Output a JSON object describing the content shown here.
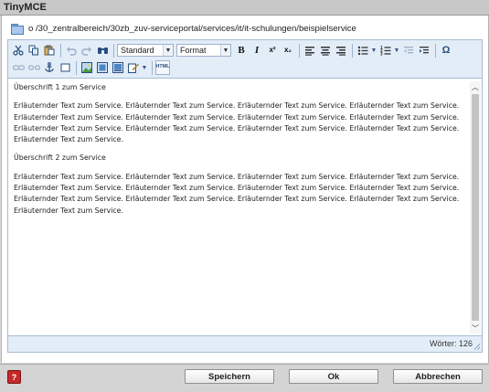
{
  "window": {
    "title": "TinyMCE"
  },
  "path": {
    "icon": "folder-icon",
    "text": "o /30_zentralbereich/30zb_zuv-serviceportal/services/it/it-schulungen/beispielservice"
  },
  "toolbar": {
    "row1": {
      "cut": "cut-icon",
      "copy": "copy-icon",
      "paste": "paste-icon",
      "undo": "undo-icon",
      "redo": "redo-icon",
      "find": "find-icon",
      "style_select": "Standard",
      "format_select": "Format",
      "bold": "B",
      "italic": "I",
      "superscript": "x²",
      "subscript": "x₂",
      "align_left": "align-left-icon",
      "align_center": "align-center-icon",
      "align_right": "align-right-icon",
      "bullet_list": "bullet-list-icon",
      "numbered_list": "numbered-list-icon",
      "outdent": "outdent-icon",
      "indent": "indent-icon",
      "charmap": "Ω"
    },
    "row2": {
      "link": "link-icon",
      "unlink": "unlink-icon",
      "anchor": "anchor-icon",
      "block": "block-icon",
      "image": "image-icon",
      "media": "media-icon",
      "insert_image": "insert-image-icon",
      "edit": "edit-icon",
      "html": "HTML"
    }
  },
  "content": {
    "heading1": "Überschrift 1 zum Service",
    "paragraph1": "Erläuternder Text zum Service. Erläuternder Text zum Service. Erläuternder Text zum Service. Erläuternder Text zum Service. Erläuternder Text zum Service. Erläuternder Text zum Service. Erläuternder Text zum Service. Erläuternder Text zum Service. Erläuternder Text zum Service. Erläuternder Text zum Service. Erläuternder Text zum Service. Erläuternder Text zum Service. Erläuternder Text zum Service.",
    "heading2": "Überschrift 2 zum Service",
    "paragraph2": "Erläuternder Text zum Service. Erläuternder Text zum Service. Erläuternder Text zum Service. Erläuternder Text zum Service. Erläuternder Text zum Service. Erläuternder Text zum Service. Erläuternder Text zum Service. Erläuternder Text zum Service. Erläuternder Text zum Service. Erläuternder Text zum Service. Erläuternder Text zum Service. Erläuternder Text zum Service. Erläuternder Text zum Service."
  },
  "status": {
    "word_count": "Wörter: 126"
  },
  "footer": {
    "help": "?",
    "save": "Speichern",
    "ok": "Ok",
    "cancel": "Abbrechen"
  },
  "colors": {
    "toolbar_bg": "#e3edf8",
    "border": "#a7bcd3",
    "help_red": "#c62828"
  }
}
